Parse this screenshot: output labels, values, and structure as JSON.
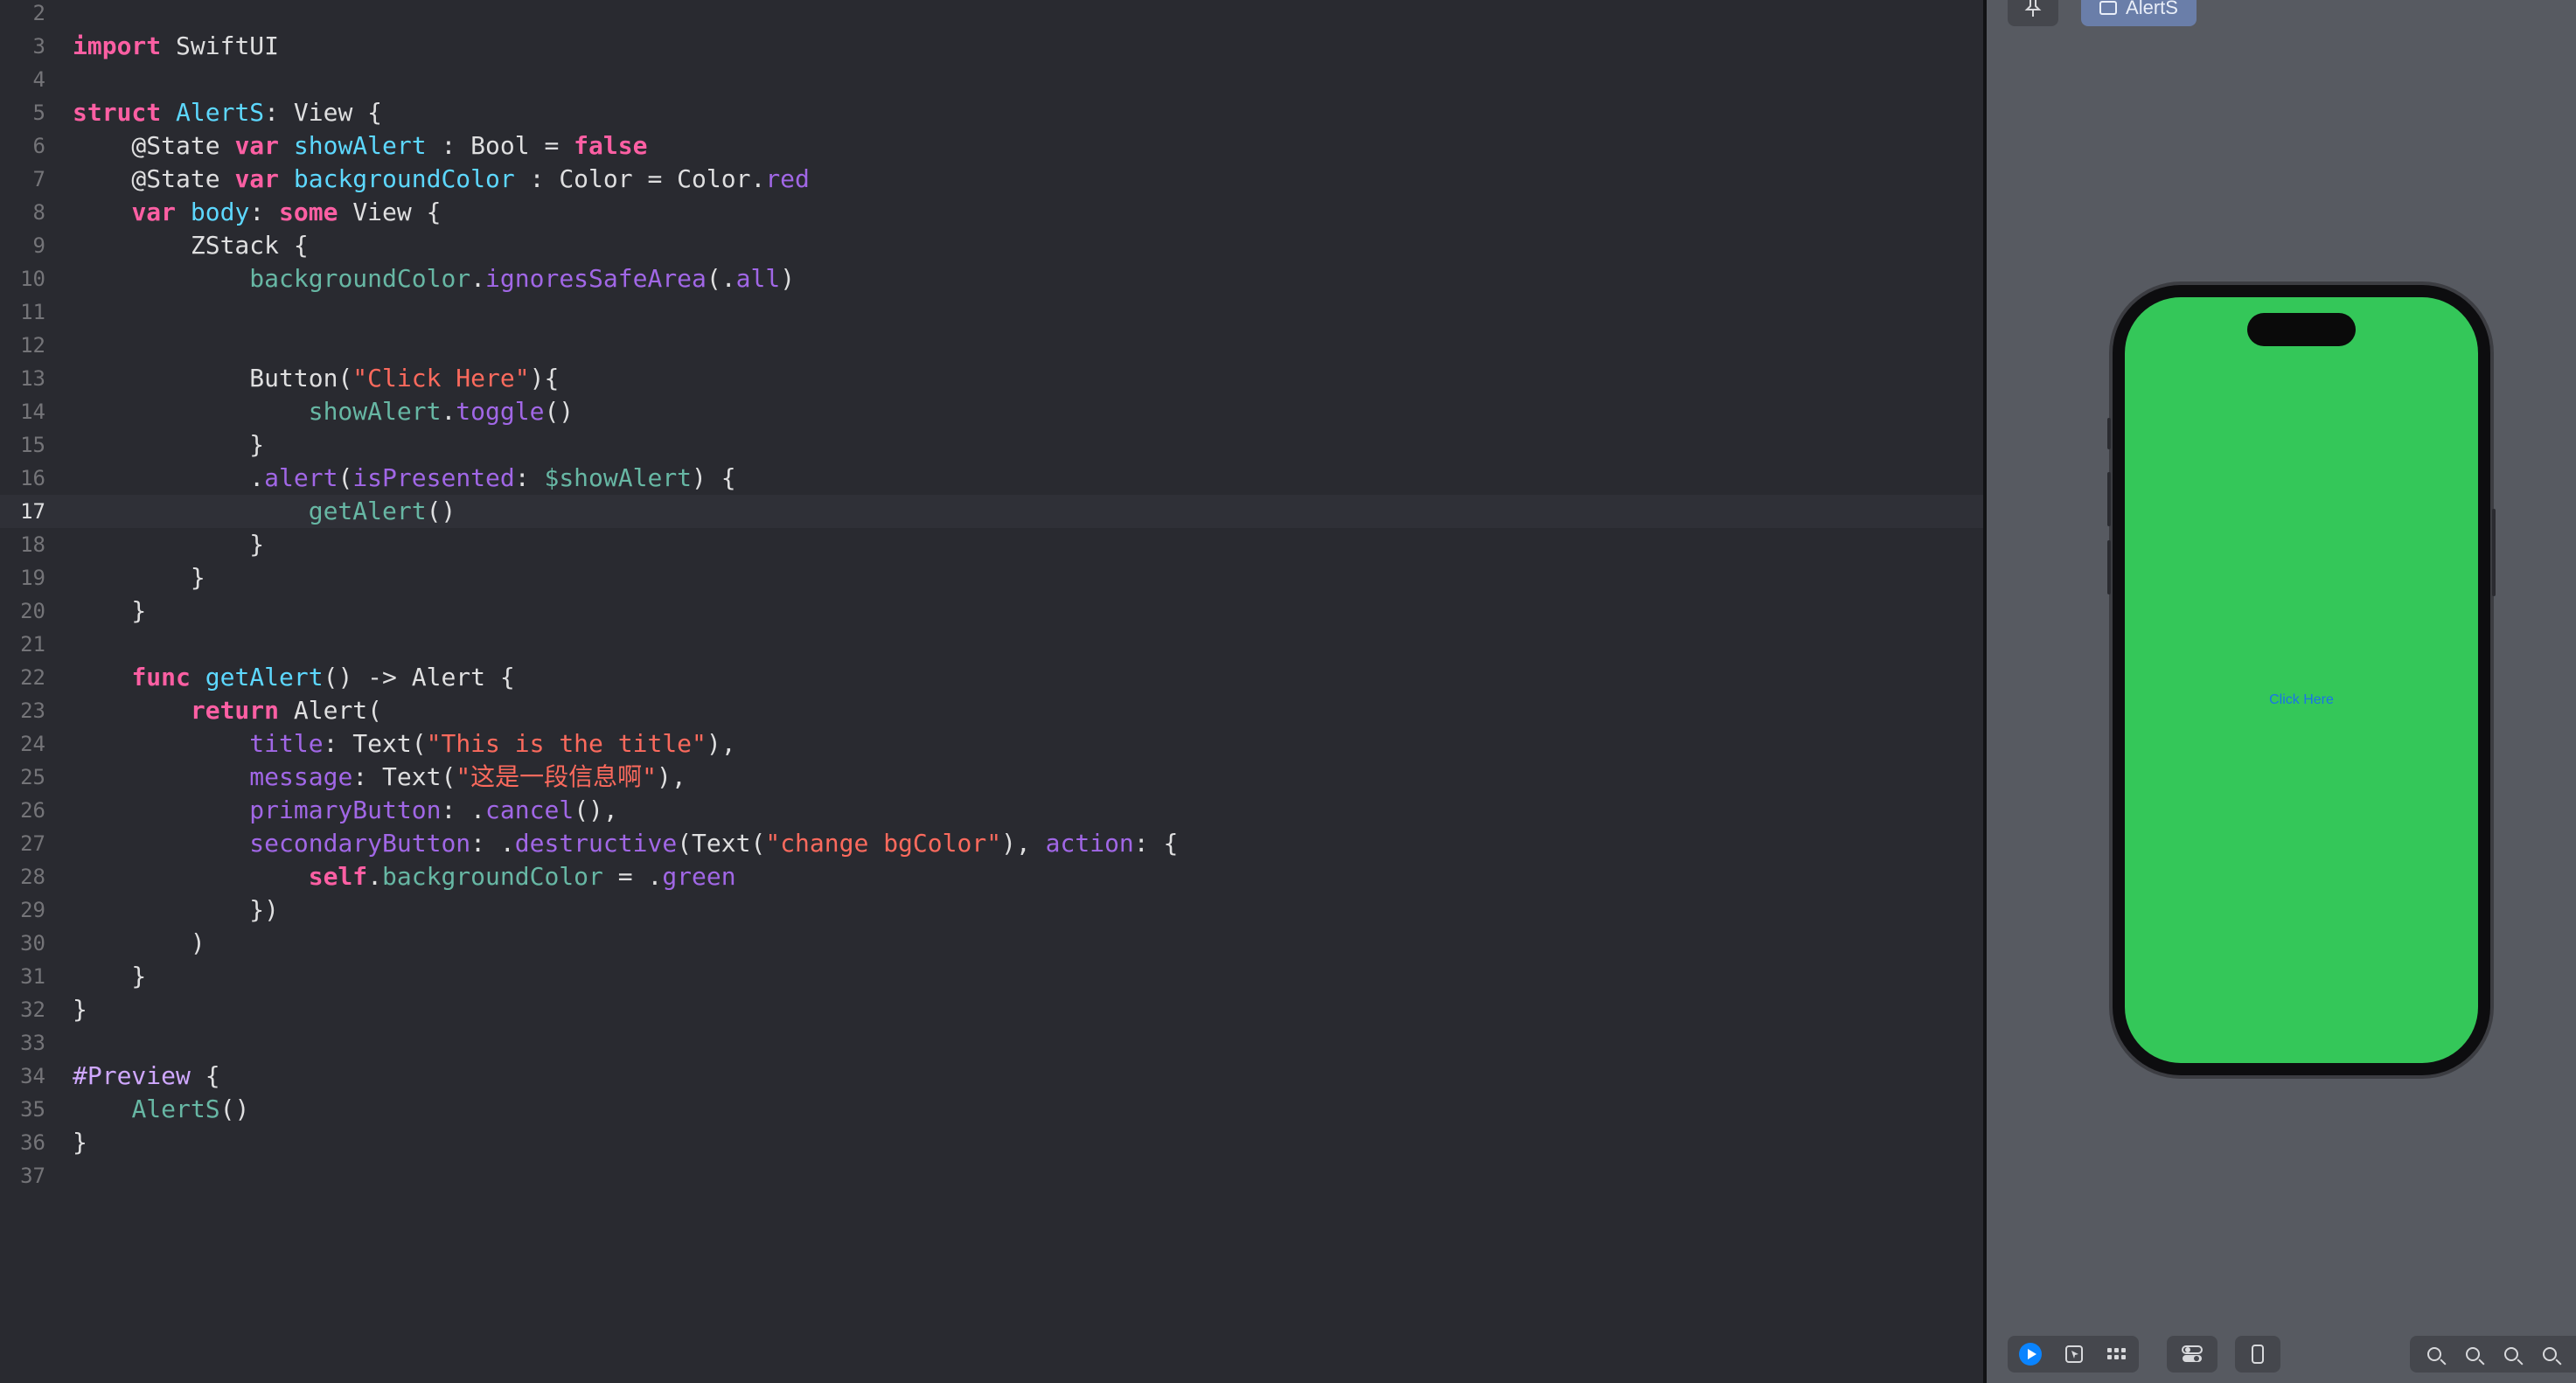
{
  "editor": {
    "current_line": 17,
    "lines": [
      {
        "n": "2",
        "tokens": []
      },
      {
        "n": "3",
        "tokens": [
          {
            "t": "import",
            "c": "kw"
          },
          {
            "t": " SwiftUI",
            "c": "pl"
          }
        ]
      },
      {
        "n": "4",
        "tokens": []
      },
      {
        "n": "5",
        "tokens": [
          {
            "t": "struct",
            "c": "kw"
          },
          {
            "t": " ",
            "c": "pl"
          },
          {
            "t": "AlertS",
            "c": "ty"
          },
          {
            "t": ": View {",
            "c": "pl"
          }
        ]
      },
      {
        "n": "6",
        "tokens": [
          {
            "t": "    @State ",
            "c": "pl"
          },
          {
            "t": "var",
            "c": "kw"
          },
          {
            "t": " ",
            "c": "pl"
          },
          {
            "t": "showAlert",
            "c": "ty"
          },
          {
            "t": " : Bool = ",
            "c": "pl"
          },
          {
            "t": "false",
            "c": "kw"
          }
        ]
      },
      {
        "n": "7",
        "tokens": [
          {
            "t": "    @State ",
            "c": "pl"
          },
          {
            "t": "var",
            "c": "kw"
          },
          {
            "t": " ",
            "c": "pl"
          },
          {
            "t": "backgroundColor",
            "c": "ty"
          },
          {
            "t": " : Color = Color.",
            "c": "pl"
          },
          {
            "t": "red",
            "c": "pr"
          }
        ]
      },
      {
        "n": "8",
        "tokens": [
          {
            "t": "    ",
            "c": "pl"
          },
          {
            "t": "var",
            "c": "kw"
          },
          {
            "t": " ",
            "c": "pl"
          },
          {
            "t": "body",
            "c": "ty"
          },
          {
            "t": ": ",
            "c": "pl"
          },
          {
            "t": "some",
            "c": "kw"
          },
          {
            "t": " View {",
            "c": "pl"
          }
        ]
      },
      {
        "n": "9",
        "tokens": [
          {
            "t": "        ZStack {",
            "c": "pl"
          }
        ]
      },
      {
        "n": "10",
        "tokens": [
          {
            "t": "            ",
            "c": "pl"
          },
          {
            "t": "backgroundColor",
            "c": "fn"
          },
          {
            "t": ".",
            "c": "pl"
          },
          {
            "t": "ignoresSafeArea",
            "c": "pr"
          },
          {
            "t": "(.",
            "c": "pl"
          },
          {
            "t": "all",
            "c": "pr"
          },
          {
            "t": ")",
            "c": "pl"
          }
        ]
      },
      {
        "n": "11",
        "tokens": []
      },
      {
        "n": "12",
        "tokens": []
      },
      {
        "n": "13",
        "tokens": [
          {
            "t": "            Button(",
            "c": "pl"
          },
          {
            "t": "\"Click Here\"",
            "c": "st"
          },
          {
            "t": "){",
            "c": "pl"
          }
        ]
      },
      {
        "n": "14",
        "tokens": [
          {
            "t": "                ",
            "c": "pl"
          },
          {
            "t": "showAlert",
            "c": "fn"
          },
          {
            "t": ".",
            "c": "pl"
          },
          {
            "t": "toggle",
            "c": "pr"
          },
          {
            "t": "()",
            "c": "pl"
          }
        ]
      },
      {
        "n": "15",
        "tokens": [
          {
            "t": "            }",
            "c": "pl"
          }
        ]
      },
      {
        "n": "16",
        "tokens": [
          {
            "t": "            .",
            "c": "pl"
          },
          {
            "t": "alert",
            "c": "pr"
          },
          {
            "t": "(",
            "c": "pl"
          },
          {
            "t": "isPresented",
            "c": "pr"
          },
          {
            "t": ": ",
            "c": "pl"
          },
          {
            "t": "$showAlert",
            "c": "fn"
          },
          {
            "t": ") {",
            "c": "pl"
          }
        ]
      },
      {
        "n": "17",
        "tokens": [
          {
            "t": "                ",
            "c": "pl"
          },
          {
            "t": "getAlert",
            "c": "fn"
          },
          {
            "t": "()",
            "c": "pl"
          }
        ]
      },
      {
        "n": "18",
        "tokens": [
          {
            "t": "            }",
            "c": "pl"
          }
        ]
      },
      {
        "n": "19",
        "tokens": [
          {
            "t": "        }",
            "c": "pl"
          }
        ]
      },
      {
        "n": "20",
        "tokens": [
          {
            "t": "    }",
            "c": "pl"
          }
        ]
      },
      {
        "n": "21",
        "tokens": []
      },
      {
        "n": "22",
        "tokens": [
          {
            "t": "    ",
            "c": "pl"
          },
          {
            "t": "func",
            "c": "kw"
          },
          {
            "t": " ",
            "c": "pl"
          },
          {
            "t": "getAlert",
            "c": "ty"
          },
          {
            "t": "() -> Alert {",
            "c": "pl"
          }
        ]
      },
      {
        "n": "23",
        "tokens": [
          {
            "t": "        ",
            "c": "pl"
          },
          {
            "t": "return",
            "c": "kw"
          },
          {
            "t": " Alert(",
            "c": "pl"
          }
        ]
      },
      {
        "n": "24",
        "tokens": [
          {
            "t": "            ",
            "c": "pl"
          },
          {
            "t": "title",
            "c": "pr"
          },
          {
            "t": ": Text(",
            "c": "pl"
          },
          {
            "t": "\"This is the title\"",
            "c": "st"
          },
          {
            "t": "),",
            "c": "pl"
          }
        ]
      },
      {
        "n": "25",
        "tokens": [
          {
            "t": "            ",
            "c": "pl"
          },
          {
            "t": "message",
            "c": "pr"
          },
          {
            "t": ": Text(",
            "c": "pl"
          },
          {
            "t": "\"这是一段信息啊\"",
            "c": "st"
          },
          {
            "t": "),",
            "c": "pl"
          }
        ]
      },
      {
        "n": "26",
        "tokens": [
          {
            "t": "            ",
            "c": "pl"
          },
          {
            "t": "primaryButton",
            "c": "pr"
          },
          {
            "t": ": .",
            "c": "pl"
          },
          {
            "t": "cancel",
            "c": "pr"
          },
          {
            "t": "(),",
            "c": "pl"
          }
        ]
      },
      {
        "n": "27",
        "tokens": [
          {
            "t": "            ",
            "c": "pl"
          },
          {
            "t": "secondaryButton",
            "c": "pr"
          },
          {
            "t": ": .",
            "c": "pl"
          },
          {
            "t": "destructive",
            "c": "pr"
          },
          {
            "t": "(Text(",
            "c": "pl"
          },
          {
            "t": "\"change bgColor\"",
            "c": "st"
          },
          {
            "t": "), ",
            "c": "pl"
          },
          {
            "t": "action",
            "c": "pr"
          },
          {
            "t": ": {",
            "c": "pl"
          }
        ]
      },
      {
        "n": "28",
        "tokens": [
          {
            "t": "                ",
            "c": "pl"
          },
          {
            "t": "self",
            "c": "kw"
          },
          {
            "t": ".",
            "c": "pl"
          },
          {
            "t": "backgroundColor",
            "c": "fn"
          },
          {
            "t": " = .",
            "c": "pl"
          },
          {
            "t": "green",
            "c": "pr"
          }
        ]
      },
      {
        "n": "29",
        "tokens": [
          {
            "t": "            })",
            "c": "pl"
          }
        ]
      },
      {
        "n": "30",
        "tokens": [
          {
            "t": "        )",
            "c": "pl"
          }
        ]
      },
      {
        "n": "31",
        "tokens": [
          {
            "t": "    }",
            "c": "pl"
          }
        ]
      },
      {
        "n": "32",
        "tokens": [
          {
            "t": "}",
            "c": "pl"
          }
        ]
      },
      {
        "n": "33",
        "tokens": []
      },
      {
        "n": "34",
        "tokens": [
          {
            "t": "#Preview",
            "c": "dc"
          },
          {
            "t": " {",
            "c": "pl"
          }
        ]
      },
      {
        "n": "35",
        "tokens": [
          {
            "t": "    ",
            "c": "pl"
          },
          {
            "t": "AlertS",
            "c": "fn"
          },
          {
            "t": "()",
            "c": "pl"
          }
        ]
      },
      {
        "n": "36",
        "tokens": [
          {
            "t": "}",
            "c": "pl"
          }
        ]
      },
      {
        "n": "37",
        "tokens": []
      }
    ]
  },
  "preview": {
    "tab_label": "AlertS",
    "button_label": "Click Here",
    "screen_color": "#34c759",
    "button_color": "#1a73e8",
    "toolbar": {
      "pin_icon": "pin-icon",
      "live_icon": "play-icon",
      "select_icon": "select-icon",
      "grid_icon": "grid-icon",
      "variants_icon": "variants-icon",
      "device_icon": "device-icon",
      "zoom_icons": [
        "zoom-out-icon",
        "zoom-fit-icon",
        "zoom-100-icon",
        "zoom-in-icon"
      ]
    }
  },
  "colors": {
    "editor_bg": "#292a30",
    "keyword": "#fc5fa3",
    "type_decl": "#5dd8ff",
    "identifier": "#67b7a4",
    "property": "#a167e6",
    "string": "#fc6a5d"
  }
}
